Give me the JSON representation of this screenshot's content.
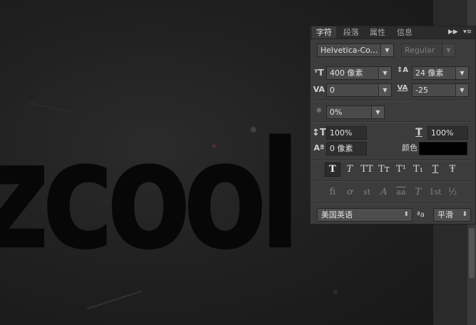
{
  "canvas": {
    "word": "zcool"
  },
  "panel": {
    "tabs": [
      "字符",
      "段落",
      "属性",
      "信息"
    ],
    "active_tab": 0,
    "expand_glyph": "▶▶",
    "menu_glyph": "▾≡",
    "font_family": "Helvetica-Co...",
    "font_style": "Regular",
    "font_size": "400 像素",
    "leading": "24 像素",
    "kerning": "0",
    "tracking": "-25",
    "tsume": "0%",
    "vertical_scale": "100%",
    "horizontal_scale": "100%",
    "baseline_shift": "0 像素",
    "color_label": "颜色：",
    "color_value": "#000000",
    "style_buttons": [
      "T",
      "T",
      "TT",
      "Tт",
      "T¹",
      "T₁",
      "T",
      "Ŧ"
    ],
    "opentype_buttons": [
      "fi",
      "ơ",
      "st",
      "A",
      "aa",
      "T",
      "1st",
      "½"
    ],
    "language": "美国英语",
    "aa_label": "ªa",
    "antialias": "平滑"
  }
}
